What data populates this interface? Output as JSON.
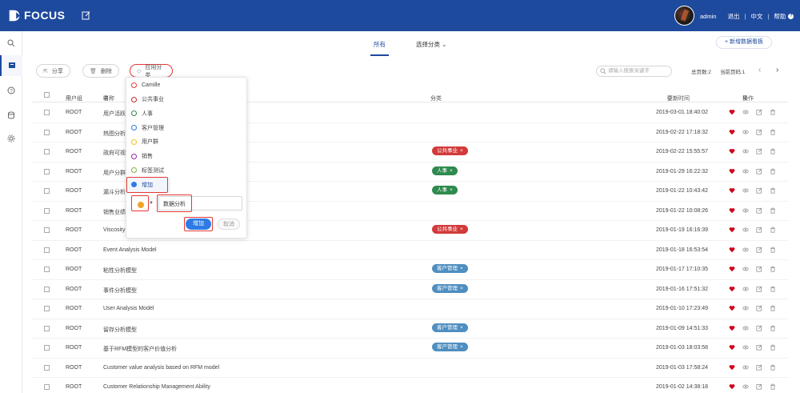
{
  "app": {
    "logo_text": "FOCUS"
  },
  "user": {
    "name": "admin",
    "logout": "退出",
    "lang": "中文",
    "help": "帮助"
  },
  "filters": {
    "all": "所有",
    "category": "选择分类"
  },
  "new_board": "+ 新增数据看板",
  "toolbar": {
    "share": "分享",
    "delete": "删除",
    "apply_category": "应用分类"
  },
  "search": {
    "placeholder": "请输入搜索关键字"
  },
  "paging": {
    "total_pages": "总页数:2",
    "current_page": "当前页码:1"
  },
  "table": {
    "headers": {
      "group": "用户组",
      "name": "名称",
      "category": "分类",
      "updated": "更新时间",
      "ops": "操作"
    },
    "rows": [
      {
        "group": "ROOT",
        "name": "用户活跃",
        "tag": "",
        "tag_color": "",
        "time": "2019-03-01 18:40:02"
      },
      {
        "group": "ROOT",
        "name": "热图分析",
        "tag": "",
        "tag_color": "",
        "time": "2019-02-22 17:18:32"
      },
      {
        "group": "ROOT",
        "name": "政府可视",
        "tag": "公共事业",
        "tag_color": "red",
        "time": "2019-02-22 15:55:57"
      },
      {
        "group": "ROOT",
        "name": "用户分群",
        "tag": "人事",
        "tag_color": "green",
        "time": "2019-01-29 16:22:32"
      },
      {
        "group": "ROOT",
        "name": "漏斗分析",
        "tag": "人事",
        "tag_color": "green",
        "time": "2019-01-22 10:43:42"
      },
      {
        "group": "ROOT",
        "name": "销售业绩",
        "tag": "",
        "tag_color": "",
        "time": "2019-01-22 10:08:26"
      },
      {
        "group": "ROOT",
        "name": "Viscosity",
        "tag": "公共事业",
        "tag_color": "red",
        "time": "2019-01-19 16:16:39"
      },
      {
        "group": "ROOT",
        "name": "Event Analysis Model",
        "tag": "",
        "tag_color": "",
        "time": "2019-01-18 16:53:54"
      },
      {
        "group": "ROOT",
        "name": "粘性分析模型",
        "tag": "客户管理",
        "tag_color": "blue",
        "time": "2019-01-17 17:10:35"
      },
      {
        "group": "ROOT",
        "name": "事件分析模型",
        "tag": "客户管理",
        "tag_color": "blue",
        "time": "2019-01-16 17:51:32"
      },
      {
        "group": "ROOT",
        "name": "User Analysis Model",
        "tag": "",
        "tag_color": "",
        "time": "2019-01-10 17:23:49"
      },
      {
        "group": "ROOT",
        "name": "留存分析模型",
        "tag": "客户管理",
        "tag_color": "blue",
        "time": "2019-01-09 14:51:33"
      },
      {
        "group": "ROOT",
        "name": "基于RFM模型的客户价值分析",
        "tag": "客户管理",
        "tag_color": "blue",
        "time": "2019-01-03 18:03:58"
      },
      {
        "group": "ROOT",
        "name": "Customer value analysis based on RFM model",
        "tag": "",
        "tag_color": "",
        "time": "2019-01-03 17:58:24"
      },
      {
        "group": "ROOT",
        "name": "Customer Relationship Management Ability",
        "tag": "",
        "tag_color": "",
        "time": "2019-01-02 14:38:18"
      }
    ]
  },
  "popover": {
    "categories": [
      {
        "label": "Camille",
        "color": "#e53935"
      },
      {
        "label": "公共事业",
        "color": "#c62828"
      },
      {
        "label": "人事",
        "color": "#2e8a4e"
      },
      {
        "label": "客户管理",
        "color": "#2d7be5"
      },
      {
        "label": "用户群",
        "color": "#f0c419"
      },
      {
        "label": "销售",
        "color": "#9c27b0"
      },
      {
        "label": "标签测试",
        "color": "#7cb342"
      }
    ],
    "add_label": "增加",
    "input_value": "数据分析",
    "confirm": "增加",
    "cancel": "取消"
  },
  "colors": {
    "brand": "#1e4a9e",
    "heart": "#d0021b",
    "highlight": "#e53935"
  }
}
